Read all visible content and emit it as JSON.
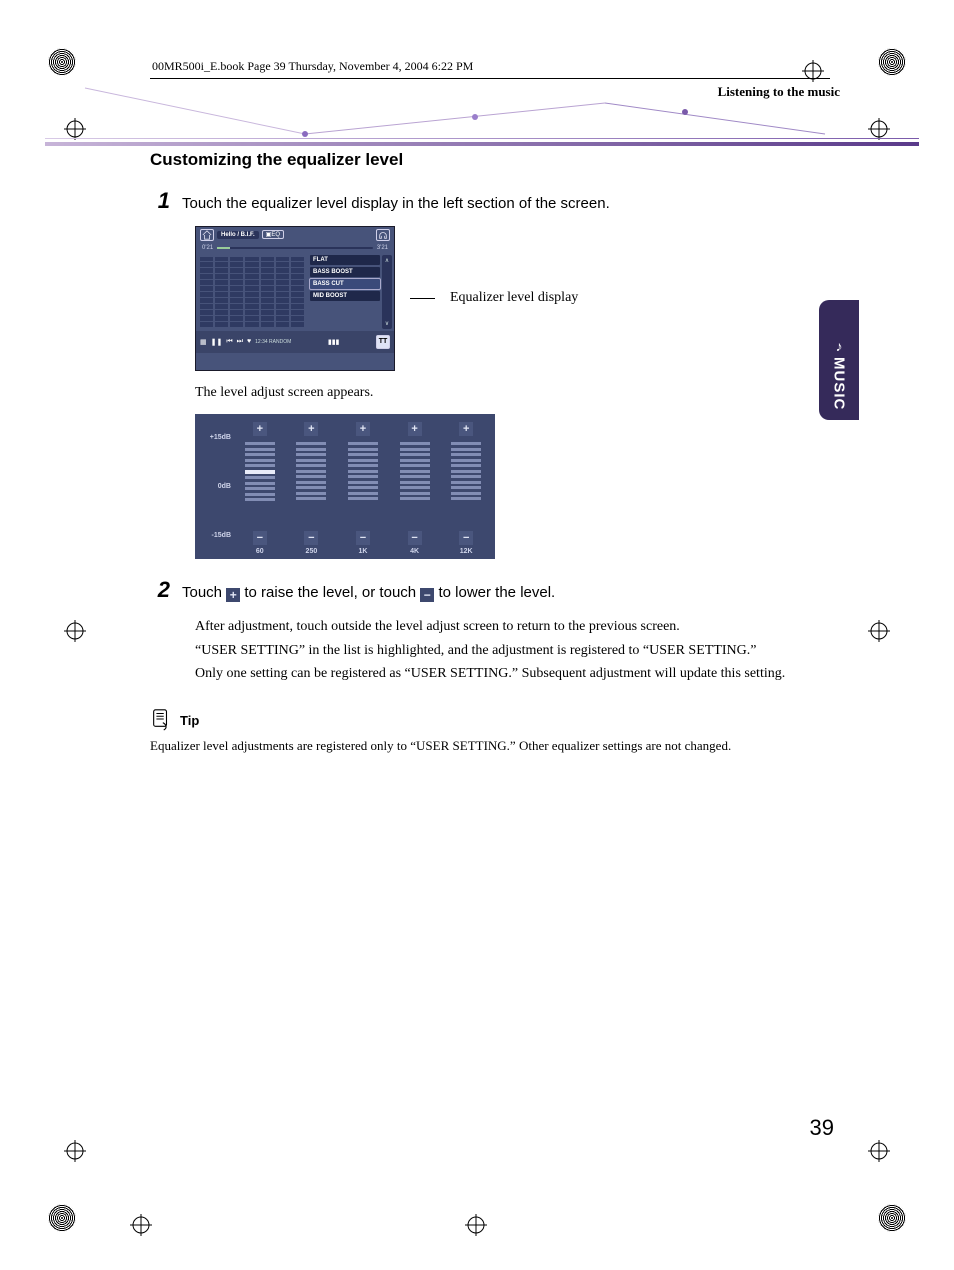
{
  "header_path": "00MR500i_E.book  Page 39  Thursday, November 4, 2004  6:22 PM",
  "breadcrumb": "Listening to the music",
  "side_tab": {
    "label": "MUSIC",
    "icon": "♪"
  },
  "section_title": "Customizing the equalizer level",
  "steps": [
    {
      "num": "1",
      "lead": "Touch the equalizer level display in the left section of the screen.",
      "callout": "Equalizer level display",
      "followup": "The level adjust screen appears."
    },
    {
      "num": "2",
      "lead_parts": [
        "Touch ",
        " to raise the level, or touch ",
        " to lower the level."
      ],
      "sub": [
        "After adjustment, touch outside the level adjust screen to return to the previous screen.",
        "“USER SETTING” in the list is highlighted, and the adjustment is registered to “USER SETTING.”",
        "Only one setting can be registered as “USER SETTING.” Subsequent adjustment will update this setting."
      ]
    }
  ],
  "tip": {
    "label": "Tip",
    "text": "Equalizer level adjustments are registered only to “USER SETTING.” Other equalizer settings are not changed."
  },
  "screenshot": {
    "title": "Hello / B.I.F.",
    "eq_btn": "EQ",
    "time_left": "0'21",
    "time_right": "3'21",
    "preset_list": [
      "FLAT",
      "BASS BOOST",
      "BASS CUT",
      "MID BOOST"
    ],
    "selected_preset_index": 2,
    "bottom_status": "12:34  RANDOM",
    "fm_tag": "TT"
  },
  "level_adjust": {
    "y_labels": [
      "+15dB",
      "0dB",
      "-15dB"
    ],
    "plus": "+",
    "minus": "−",
    "bands": [
      "60",
      "250",
      "1K",
      "4K",
      "12K"
    ]
  },
  "page_number": "39"
}
